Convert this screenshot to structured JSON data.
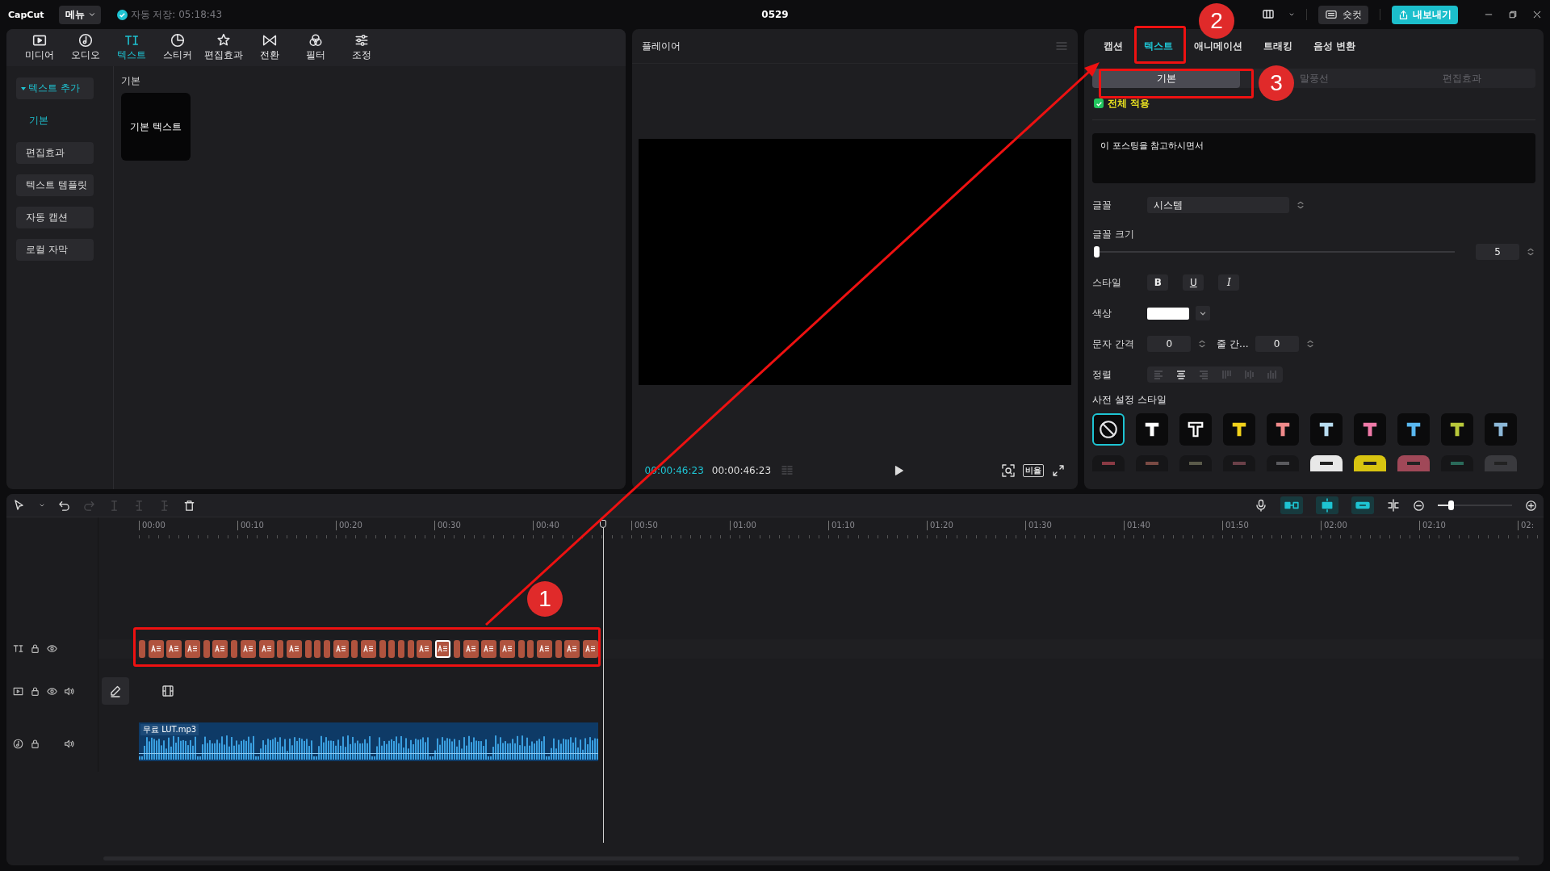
{
  "app": {
    "logo": "CapCut",
    "menu": "메뉴",
    "autosave": "자동 저장: 05:18:43",
    "project_title": "0529",
    "shortcut_button": "숏컷",
    "export_button": "내보내기"
  },
  "media_tabs": [
    {
      "label": "미디어",
      "kind": "media",
      "selected": false
    },
    {
      "label": "오디오",
      "kind": "audio",
      "selected": false
    },
    {
      "label": "텍스트",
      "kind": "text",
      "selected": true
    },
    {
      "label": "스티커",
      "kind": "sticker",
      "selected": false
    },
    {
      "label": "편집효과",
      "kind": "effect",
      "selected": false
    },
    {
      "label": "전환",
      "kind": "transition",
      "selected": false
    },
    {
      "label": "필터",
      "kind": "filter",
      "selected": false
    },
    {
      "label": "조정",
      "kind": "adjust",
      "selected": false
    }
  ],
  "text_sidebar": [
    {
      "label": "텍스트 추가",
      "kind": "group",
      "selected": false
    },
    {
      "label": "기본",
      "kind": "sub",
      "selected": true
    },
    {
      "label": "편집효과",
      "kind": "item",
      "selected": false
    },
    {
      "label": "텍스트 템플릿",
      "kind": "item",
      "selected": false
    },
    {
      "label": "자동 캡션",
      "kind": "item",
      "selected": false
    },
    {
      "label": "로컬 자막",
      "kind": "item",
      "selected": false
    }
  ],
  "library": {
    "section": "기본",
    "items": [
      {
        "label": "기본 텍스트"
      }
    ]
  },
  "player": {
    "title": "플레이어",
    "current_time": "00:00:46:23",
    "total_time": "00:00:46:23",
    "ratio_button": "비율"
  },
  "inspector": {
    "tabs": [
      {
        "label": "캡션",
        "selected": false
      },
      {
        "label": "텍스트",
        "selected": true
      },
      {
        "label": "애니메이션",
        "selected": false
      },
      {
        "label": "트래킹",
        "selected": false
      },
      {
        "label": "음성 변환",
        "selected": false
      }
    ],
    "subtabs": [
      {
        "label": "기본",
        "selected": true
      },
      {
        "label": "말풍선",
        "selected": false
      },
      {
        "label": "편집효과",
        "selected": false
      }
    ],
    "apply_all": {
      "label": "전체 적용",
      "checked": true
    },
    "text_value": "이 포스팅을 참고하시면서",
    "font": {
      "label": "글꼴",
      "value": "시스템"
    },
    "font_size": {
      "label": "글꼴 크기",
      "level": 0.0,
      "value": "5"
    },
    "style": {
      "label": "스타일",
      "buttons": [
        {
          "label": "B",
          "kind": "bold",
          "selected": false
        },
        {
          "label": "U",
          "kind": "underline",
          "selected": false
        },
        {
          "label": "I",
          "kind": "italic",
          "selected": false
        }
      ]
    },
    "color": {
      "label": "색상",
      "color": "#ffffff"
    },
    "letter_spacing": {
      "label": "문자 간격",
      "value": "0"
    },
    "line_spacing": {
      "label": "줄 간...",
      "value": "0"
    },
    "alignment": {
      "label": "정렬",
      "options": [
        {
          "kind": "left",
          "selected": false
        },
        {
          "kind": "center",
          "selected": true
        },
        {
          "kind": "right",
          "selected": false
        },
        {
          "kind": "top",
          "selected": false
        },
        {
          "kind": "middle",
          "selected": false
        },
        {
          "kind": "bottom",
          "selected": false
        }
      ]
    },
    "presets": {
      "label": "사전 설정 스타일",
      "items": [
        {
          "kind": "none",
          "selected": true
        },
        {
          "kind": "solid",
          "color": "#ffffff",
          "selected": false
        },
        {
          "kind": "outline",
          "color": "#ffffff",
          "selected": false
        },
        {
          "kind": "solid",
          "color": "#f2d21b",
          "selected": false
        },
        {
          "kind": "solid",
          "color": "#f08a8a",
          "selected": false
        },
        {
          "kind": "solid",
          "color": "#b8dcf0",
          "selected": false
        },
        {
          "kind": "solid",
          "color": "#f07aa8",
          "selected": false
        },
        {
          "kind": "solid",
          "color": "#5ab8f0",
          "selected": false
        },
        {
          "kind": "solid",
          "color": "#b8c83a",
          "selected": false
        },
        {
          "kind": "solid",
          "color": "#8cb8d8",
          "selected": false
        }
      ],
      "more": [
        {
          "kind": "dark",
          "color": "#8a3a44"
        },
        {
          "kind": "dark",
          "color": "#7a4a44"
        },
        {
          "kind": "dark",
          "color": "#5a5a4a"
        },
        {
          "kind": "dark",
          "color": "#6a4048"
        },
        {
          "kind": "dark",
          "color": "#5a5a5e"
        },
        {
          "kind": "filled",
          "color": "#e8e8e8"
        },
        {
          "kind": "filled",
          "color": "#d8c410"
        },
        {
          "kind": "filled",
          "color": "#a04858"
        },
        {
          "kind": "dark",
          "color": "#2a6a5a"
        },
        {
          "kind": "filled",
          "color": "#3a3a3e"
        }
      ]
    }
  },
  "timeline": {
    "zoom": {
      "level": 0.15
    },
    "ruler": [
      "00:00",
      "00:10",
      "00:20",
      "00:30",
      "00:40",
      "00:50",
      "01:00",
      "01:10",
      "01:20",
      "01:30",
      "01:40",
      "01:50",
      "02:00",
      "02:10",
      "02:"
    ],
    "tracks": [
      {
        "kind": "text",
        "clips": [
          {
            "kind": "narrow",
            "selected": false
          },
          {
            "kind": "full",
            "selected": false
          },
          {
            "kind": "full",
            "selected": false
          },
          {
            "kind": "full",
            "selected": false
          },
          {
            "kind": "narrow",
            "selected": false
          },
          {
            "kind": "full",
            "selected": false
          },
          {
            "kind": "narrow",
            "selected": false
          },
          {
            "kind": "full",
            "selected": false
          },
          {
            "kind": "full",
            "selected": false
          },
          {
            "kind": "narrow",
            "selected": false
          },
          {
            "kind": "full",
            "selected": false
          },
          {
            "kind": "narrow",
            "selected": false
          },
          {
            "kind": "narrow",
            "selected": false
          },
          {
            "kind": "narrow",
            "selected": false
          },
          {
            "kind": "full",
            "selected": false
          },
          {
            "kind": "narrow",
            "selected": false
          },
          {
            "kind": "full",
            "selected": false
          },
          {
            "kind": "narrow",
            "selected": false
          },
          {
            "kind": "narrow",
            "selected": false
          },
          {
            "kind": "narrow",
            "selected": false
          },
          {
            "kind": "narrow",
            "selected": false
          },
          {
            "kind": "full",
            "selected": false
          },
          {
            "kind": "full",
            "selected": true
          },
          {
            "kind": "narrow",
            "selected": false
          },
          {
            "kind": "full",
            "selected": false
          },
          {
            "kind": "full",
            "selected": false
          },
          {
            "kind": "full",
            "selected": false
          },
          {
            "kind": "narrow",
            "selected": false
          },
          {
            "kind": "narrow",
            "selected": false
          },
          {
            "kind": "full",
            "selected": false
          },
          {
            "kind": "narrow",
            "selected": false
          },
          {
            "kind": "full",
            "selected": false
          },
          {
            "kind": "full",
            "selected": false
          }
        ]
      },
      {
        "kind": "video"
      },
      {
        "kind": "audio",
        "clip_name": "무료 LUT.mp3"
      }
    ]
  },
  "annotations": [
    {
      "label": "1"
    },
    {
      "label": "2"
    },
    {
      "label": "3"
    }
  ]
}
